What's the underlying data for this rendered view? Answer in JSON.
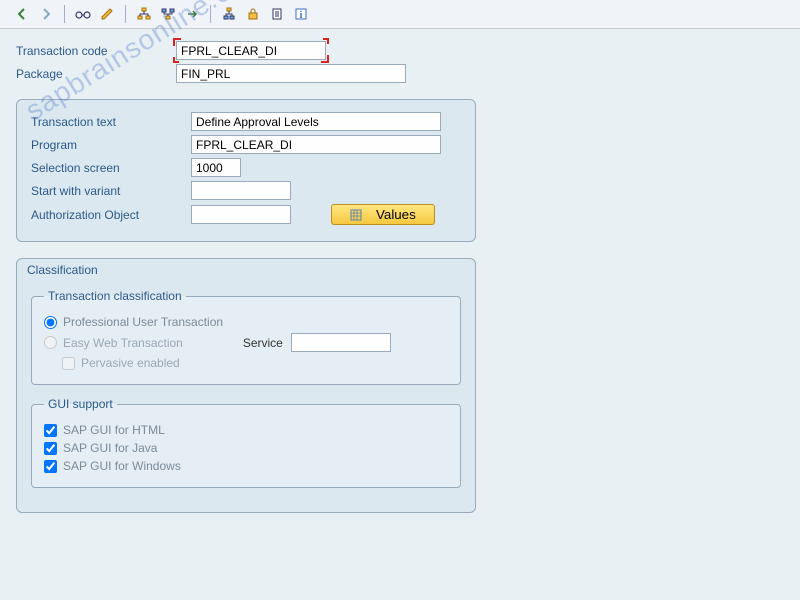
{
  "watermark": "sapbrainsonline.com",
  "fields": {
    "tcode_label": "Transaction code",
    "tcode_value": "FPRL_CLEAR_DI",
    "package_label": "Package",
    "package_value": "FIN_PRL"
  },
  "detail": {
    "ttext_label": "Transaction text",
    "ttext_value": "Define Approval Levels",
    "program_label": "Program",
    "program_value": "FPRL_CLEAR_DI",
    "selscreen_label": "Selection screen",
    "selscreen_value": "1000",
    "variant_label": "Start with variant",
    "variant_value": "",
    "authobj_label": "Authorization Object",
    "authobj_value": "",
    "values_button": "Values"
  },
  "classification": {
    "title": "Classification",
    "tc_title": "Transaction classification",
    "radio_prof": "Professional User Transaction",
    "radio_easy": "Easy Web Transaction",
    "service_label": "Service",
    "service_value": "",
    "pervasive": "Pervasive enabled",
    "gui_title": "GUI support",
    "gui_html": "SAP GUI for HTML",
    "gui_java": "SAP GUI for Java",
    "gui_win": "SAP GUI for Windows"
  }
}
